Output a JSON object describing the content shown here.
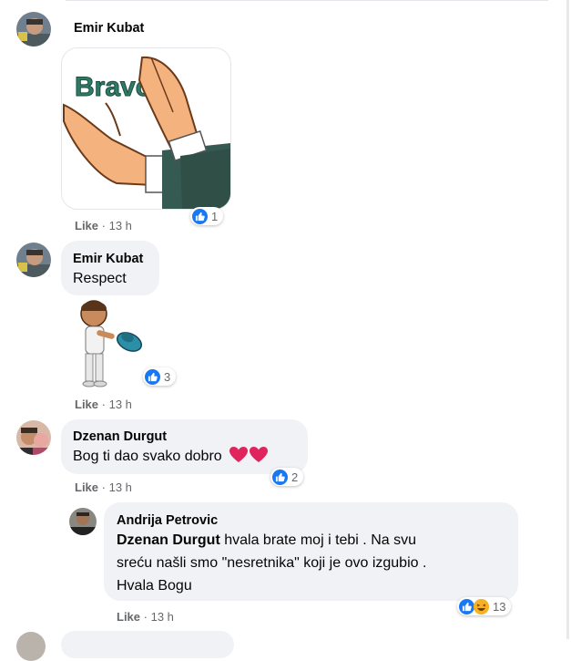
{
  "comments": [
    {
      "author": "Emir Kubat",
      "sticker": "bravo-clapping-hands-sticker",
      "sticker_text": "Bravo",
      "like_label": "Like",
      "time": "13 h",
      "reaction_count": "1"
    },
    {
      "author": "Emir Kubat",
      "text": "Respect",
      "sticker": "tipping-hat-character-sticker",
      "like_label": "Like",
      "time": "13 h",
      "reaction_count": "3"
    },
    {
      "author": "Dzenan Durgut",
      "text": "Bog ti dao svako dobro",
      "emoji": "two-red-hearts",
      "like_label": "Like",
      "time": "13 h",
      "reaction_count": "2"
    }
  ],
  "reply": {
    "author": "Andrija Petrovic",
    "mention": "Dzenan Durgut",
    "line1": " hvala brate moj i tebi . Na svu",
    "line2": "sreću našli smo \"nesretnika\" koji je ovo izgubio .",
    "line3": "Hvala Bogu",
    "like_label": "Like",
    "time": "13 h",
    "reaction_count": "13"
  },
  "separator": "·",
  "colors": {
    "like_blue": "#1877f2",
    "bubble": "#f0f2f5",
    "meta": "#65676b",
    "heart": "#e0245e"
  }
}
